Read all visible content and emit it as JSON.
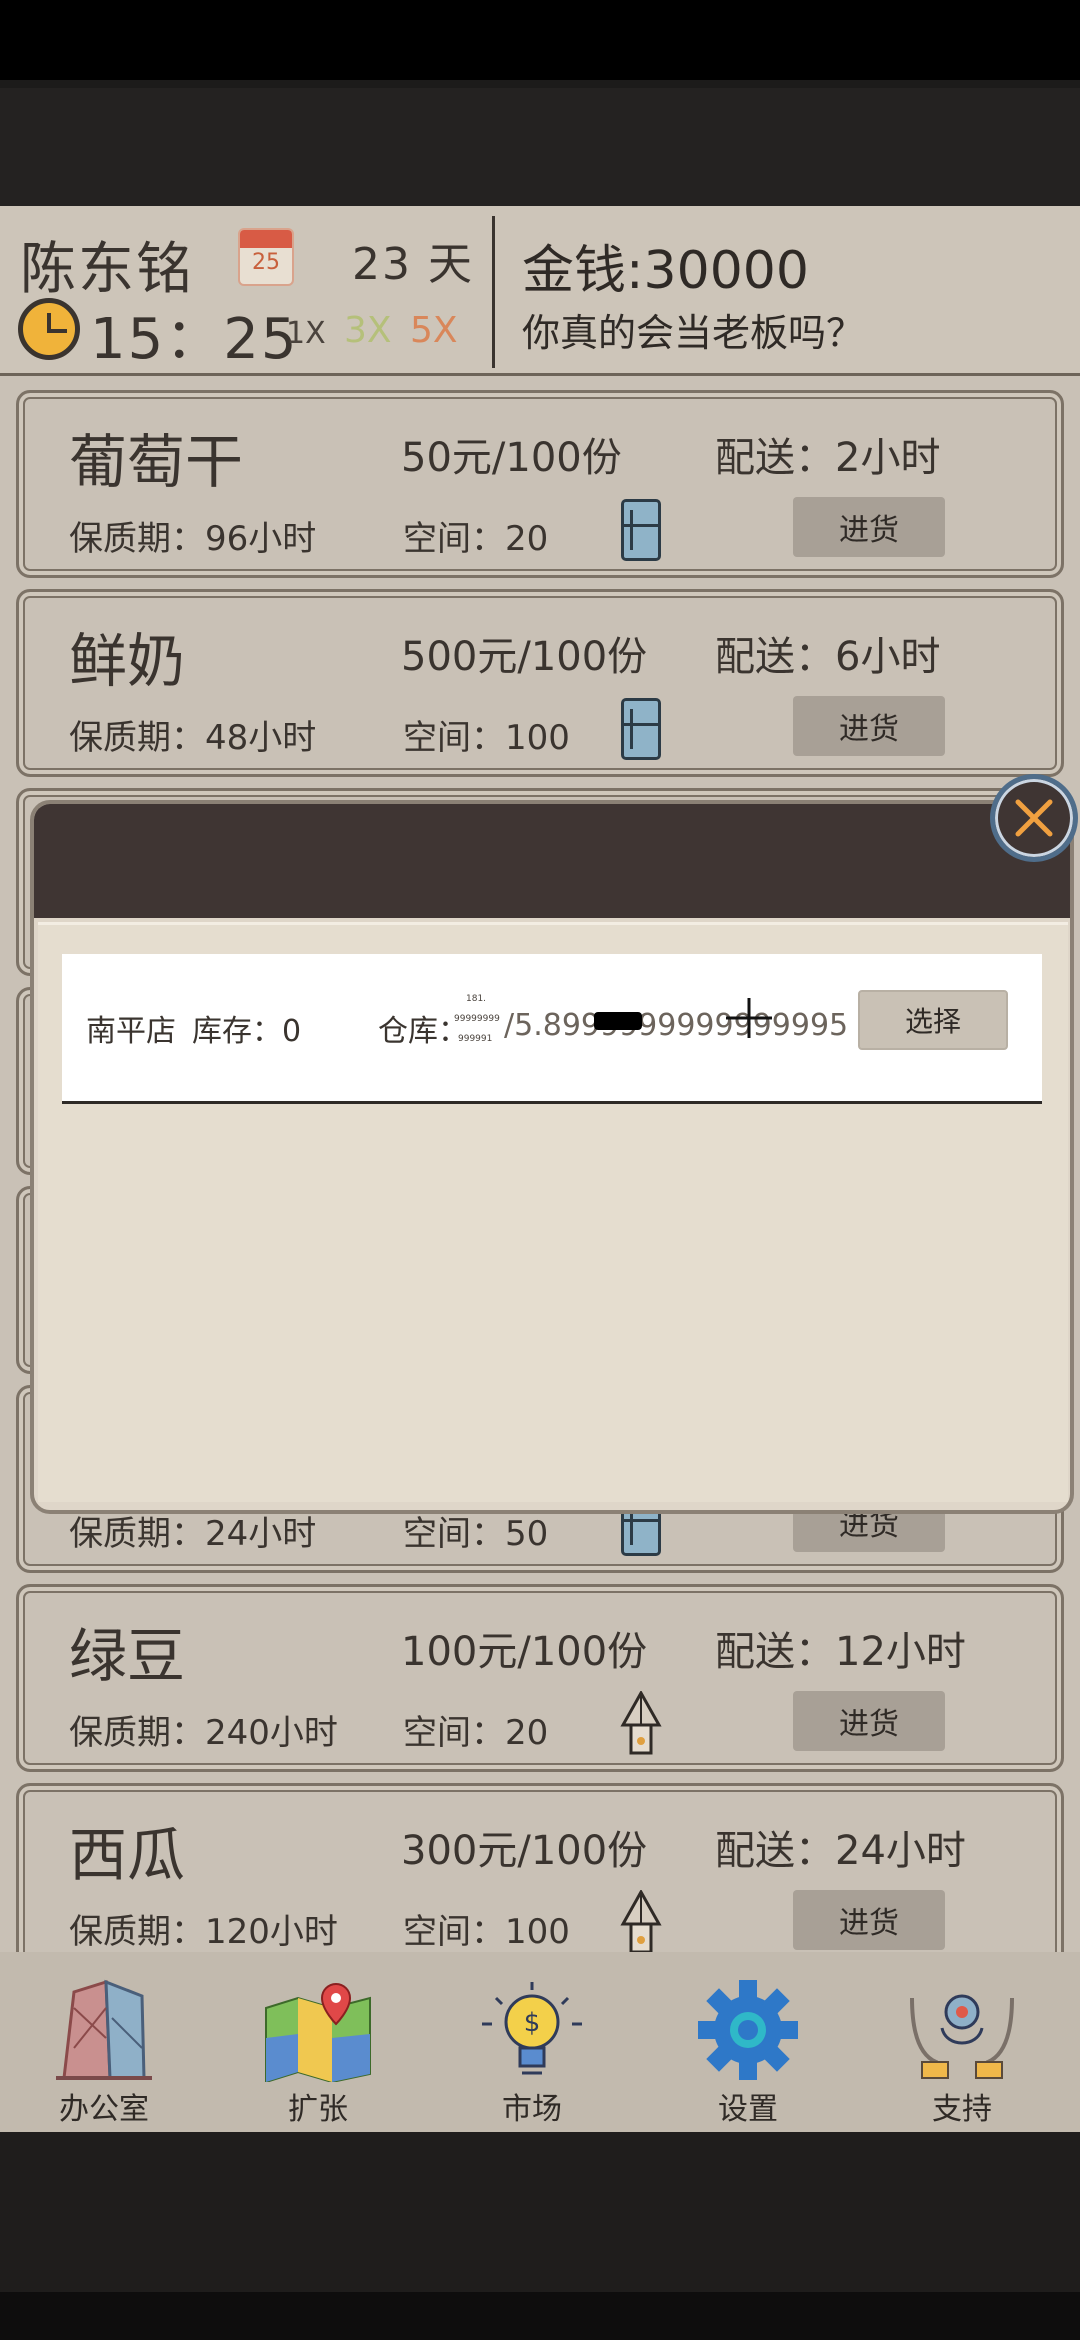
{
  "header": {
    "player_name": "陈东铭",
    "calendar_day": "25",
    "days": "23 天",
    "time": "15：25",
    "speeds": [
      "1X",
      "3X",
      "5X"
    ],
    "money": "金钱:30000",
    "slogan": "你真的会当老板吗？"
  },
  "products": [
    {
      "name": "葡萄干",
      "price": "50元/100份",
      "delivery": "配送：2小时",
      "shelf_life": "保质期：96小时",
      "space": "空间：20",
      "storage_icon": "fridge-icon",
      "buy_label": "进货"
    },
    {
      "name": "鲜奶",
      "price": "500元/100份",
      "delivery": "配送：6小时",
      "shelf_life": "保质期：48小时",
      "space": "空间：100",
      "storage_icon": "fridge-icon",
      "buy_label": "进货"
    },
    {
      "shelf_life": "保质期：24小时",
      "space": "空间：50",
      "storage_icon": "fridge-icon",
      "buy_label": "进货"
    },
    {
      "name": "绿豆",
      "price": "100元/100份",
      "delivery": "配送：12小时",
      "shelf_life": "保质期：240小时",
      "space": "空间：20",
      "storage_icon": "tent-icon",
      "buy_label": "进货"
    },
    {
      "name": "西瓜",
      "price": "300元/100份",
      "delivery": "配送：24小时",
      "shelf_life": "保质期：120小时",
      "space": "空间：100",
      "storage_icon": "tent-icon",
      "buy_label": "进货"
    }
  ],
  "dialog": {
    "store_name": "南平店",
    "stock": "库存：0",
    "warehouse_label": "仓库：",
    "tiny_lines": [
      "181.",
      "99999999",
      "999991"
    ],
    "capacity": "/5.8999999999999995",
    "select_label": "选择"
  },
  "nav": [
    {
      "label": "办公室",
      "icon": "office-building-icon"
    },
    {
      "label": "扩张",
      "icon": "map-icon"
    },
    {
      "label": "市场",
      "icon": "lightbulb-icon"
    },
    {
      "label": "设置",
      "icon": "gear-icon"
    },
    {
      "label": "支持",
      "icon": "support-hands-icon"
    }
  ],
  "colors": {
    "background": "#c9c1b6",
    "dialog_header": "#3f3533",
    "close_x": "#f0a040",
    "speed_3x": "#b5c07a",
    "speed_5x": "#d9875a"
  }
}
